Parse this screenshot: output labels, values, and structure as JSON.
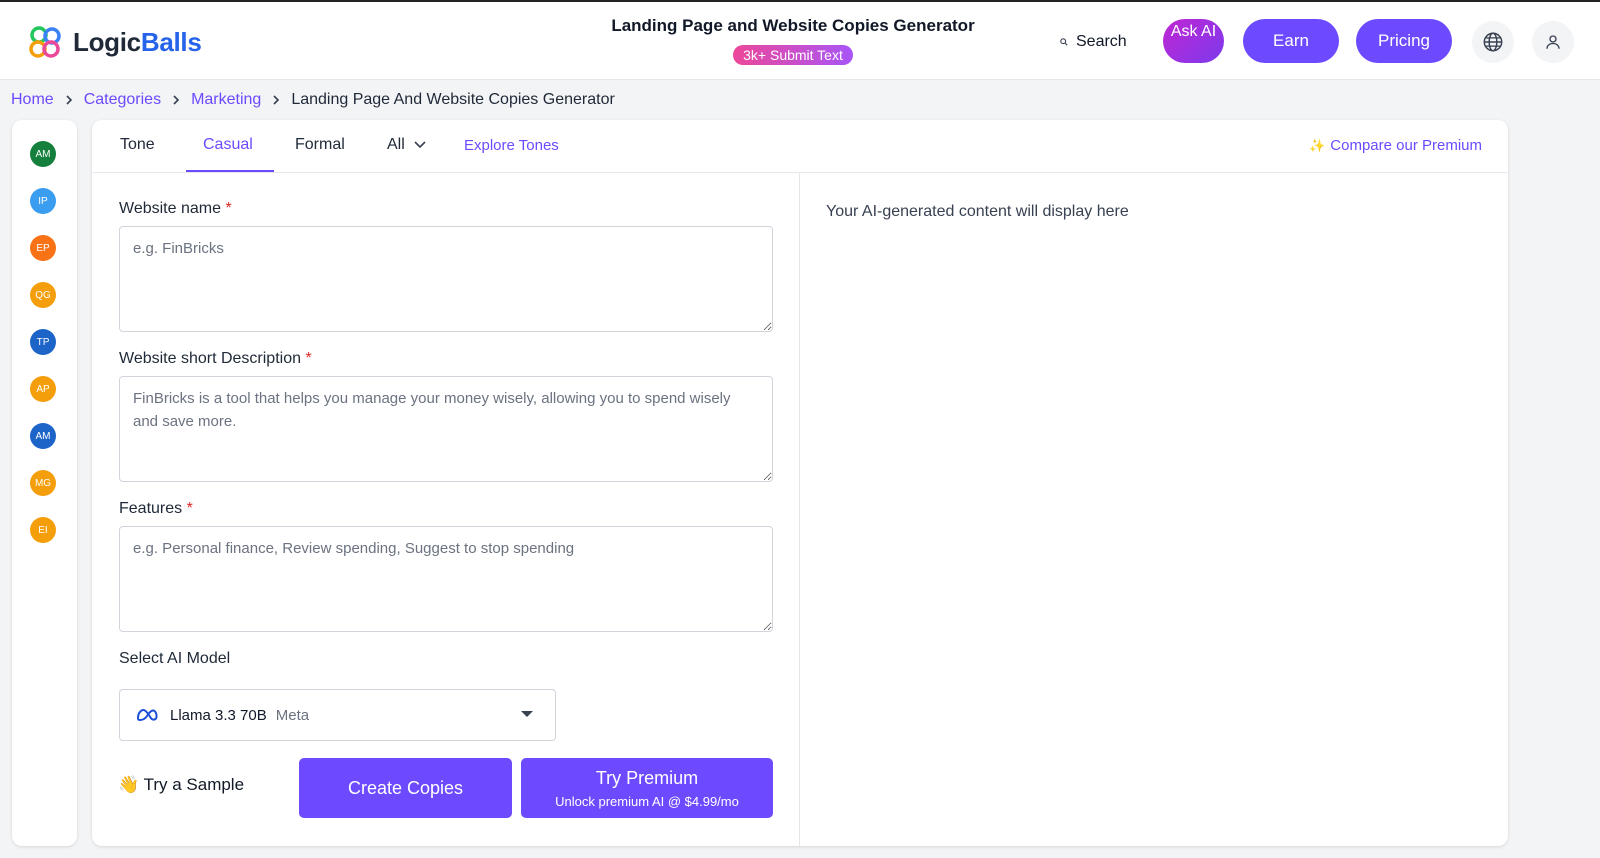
{
  "header": {
    "logo_text_a": "Logic",
    "logo_text_b": "Balls",
    "page_title": "Landing Page and Website Copies Generator",
    "badge": "3k+ Submit Text",
    "search_label": "Search",
    "ask_ai": "Ask AI",
    "earn": "Earn",
    "pricing": "Pricing",
    "icons": [
      "search-icon",
      "globe-icon",
      "user-icon"
    ]
  },
  "breadcrumb": {
    "items": [
      "Home",
      "Categories",
      "Marketing"
    ],
    "current": "Landing Page And Website Copies Generator"
  },
  "sidebar": {
    "avatars": [
      {
        "initials": "AM",
        "color": "#15803d"
      },
      {
        "initials": "IP",
        "color": "#3b9df0"
      },
      {
        "initials": "EP",
        "color": "#f97316"
      },
      {
        "initials": "QG",
        "color": "#f59e0b"
      },
      {
        "initials": "TP",
        "color": "#1d64c8"
      },
      {
        "initials": "AP",
        "color": "#f59e0b"
      },
      {
        "initials": "AM",
        "color": "#1d64c8"
      },
      {
        "initials": "MG",
        "color": "#f59e0b"
      },
      {
        "initials": "EI",
        "color": "#f59e0b"
      }
    ]
  },
  "tabs": {
    "tone": "Tone",
    "casual": "Casual",
    "formal": "Formal",
    "all": "All",
    "explore": "Explore Tones",
    "compare": "Compare our Premium",
    "active": "Casual"
  },
  "form": {
    "website_name": {
      "label": "Website name",
      "required": "*",
      "placeholder": "e.g. FinBricks",
      "value": ""
    },
    "description": {
      "label": "Website short Description",
      "required": "*",
      "placeholder": "FinBricks is a tool that helps you manage your money wisely, allowing you to spend wisely and save more.",
      "value": ""
    },
    "features": {
      "label": "Features",
      "required": "*",
      "placeholder": "e.g. Personal finance, Review spending, Suggest to stop spending",
      "value": ""
    },
    "model_label": "Select AI Model",
    "model_name": "Llama 3.3 70B",
    "model_vendor": "Meta",
    "sample": "👋 Try a Sample",
    "create": "Create Copies",
    "try_premium": "Try Premium",
    "try_premium_sub": "Unlock premium AI @ $4.99/mo"
  },
  "output": {
    "placeholder": "Your AI-generated content will display here"
  },
  "colors": {
    "accent": "#6d4aff",
    "required": "#dc2626"
  }
}
